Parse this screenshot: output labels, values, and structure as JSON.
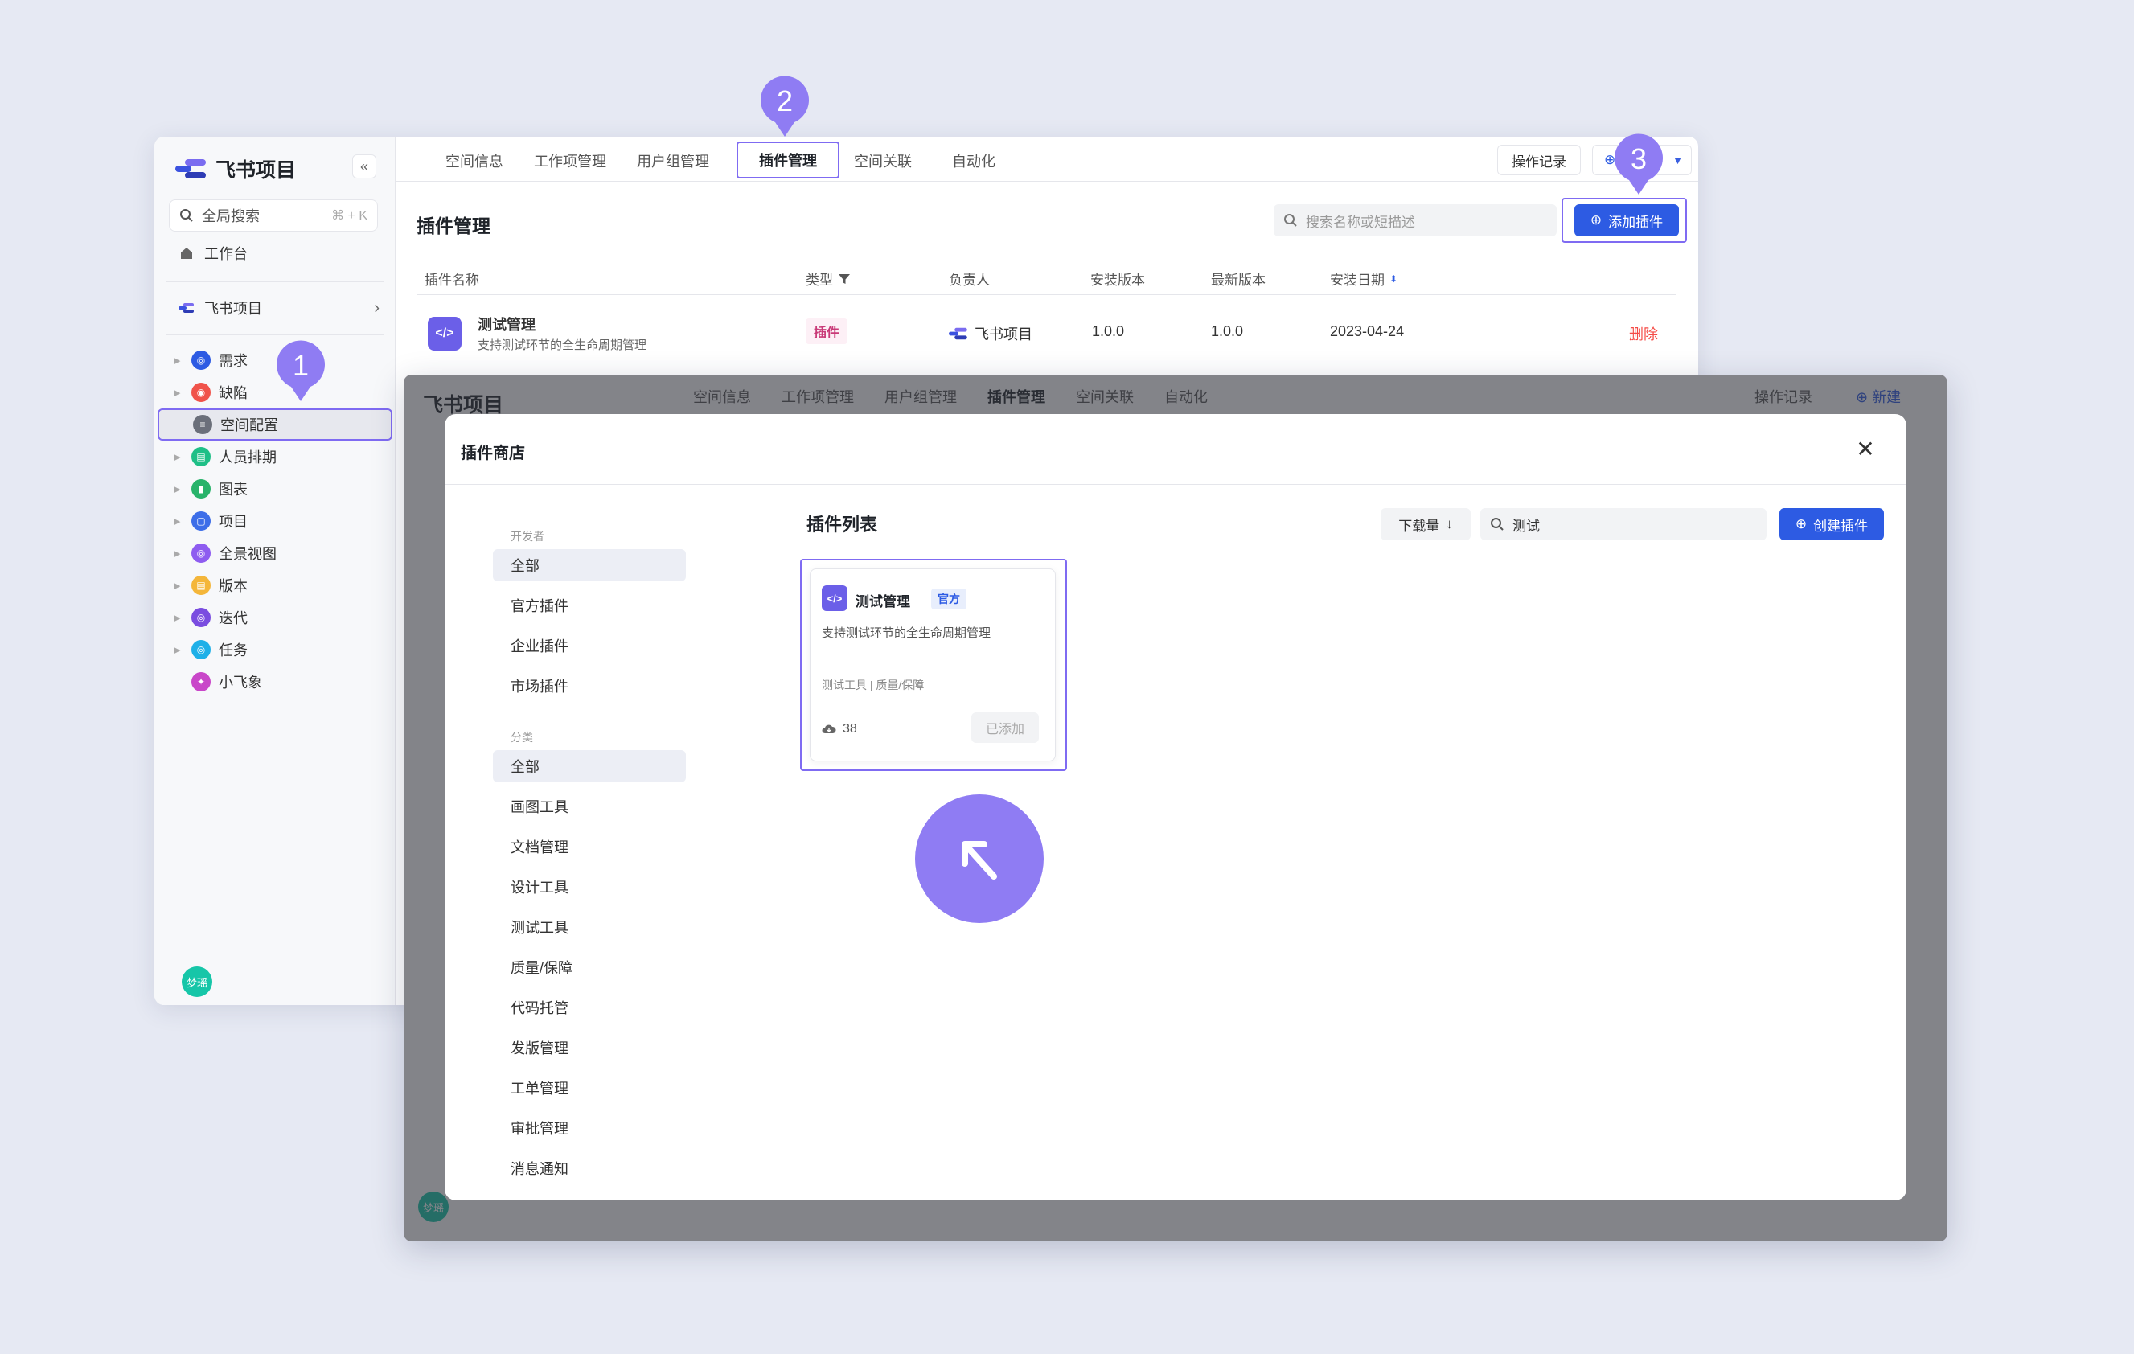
{
  "app": {
    "name": "飞书项目",
    "collapse_icon": "«",
    "search_label": "全局搜索",
    "search_shortcut": "⌘ + K",
    "workbench": "工作台",
    "space_name": "飞书项目",
    "user_avatar": "梦瑶"
  },
  "tree": [
    {
      "label": "需求",
      "color": "#2d5be3",
      "glyph": "◎"
    },
    {
      "label": "缺陷",
      "color": "#f0534a",
      "glyph": "◉"
    },
    {
      "label": "空间配置",
      "color": "#6b6f7a",
      "glyph": "≡"
    },
    {
      "label": "人员排期",
      "color": "#1fbf87",
      "glyph": "▤"
    },
    {
      "label": "图表",
      "color": "#28b36a",
      "glyph": "▮"
    },
    {
      "label": "项目",
      "color": "#3d6ee8",
      "glyph": "▢"
    },
    {
      "label": "全景视图",
      "color": "#8e5cf0",
      "glyph": "◎"
    },
    {
      "label": "版本",
      "color": "#f4b63a",
      "glyph": "▤"
    },
    {
      "label": "迭代",
      "color": "#7a4de0",
      "glyph": "◎"
    },
    {
      "label": "任务",
      "color": "#1eb0e8",
      "glyph": "◎"
    },
    {
      "label": "小飞象",
      "color": "#c947c9",
      "glyph": "✦"
    }
  ],
  "tabs": [
    "空间信息",
    "工作项管理",
    "用户组管理",
    "插件管理",
    "空间关联",
    "自动化"
  ],
  "actions": {
    "op_record": "操作记录",
    "new": "新建"
  },
  "plugin_page": {
    "title": "插件管理",
    "search_placeholder": "搜索名称或短描述",
    "add_button": "添加插件",
    "columns": [
      "插件名称",
      "类型",
      "负责人",
      "安装版本",
      "最新版本",
      "安装日期"
    ],
    "row": {
      "name": "测试管理",
      "desc": "支持测试环节的全生命周期管理",
      "type": "插件",
      "owner": "飞书项目",
      "installed": "1.0.0",
      "latest": "1.0.0",
      "date": "2023-04-24",
      "delete": "删除"
    }
  },
  "store": {
    "title": "插件商店",
    "dev_label": "开发者",
    "dev_filters": [
      "全部",
      "官方插件",
      "企业插件",
      "市场插件"
    ],
    "cat_label": "分类",
    "cat_filters": [
      "全部",
      "画图工具",
      "文档管理",
      "设计工具",
      "测试工具",
      "质量/保障",
      "代码托管",
      "发版管理",
      "工单管理",
      "审批管理",
      "消息通知"
    ],
    "list_title": "插件列表",
    "sort": "下载量",
    "search_value": "测试",
    "create_button": "创建插件",
    "card": {
      "name": "测试管理",
      "badge": "官方",
      "desc": "支持测试环节的全生命周期管理",
      "tags": "测试工具 | 质量/保障",
      "downloads": "38",
      "status": "已添加"
    }
  },
  "markers": [
    "1",
    "2",
    "3"
  ],
  "marker_color": "#8f7cf3",
  "accent": "#2d5be3"
}
